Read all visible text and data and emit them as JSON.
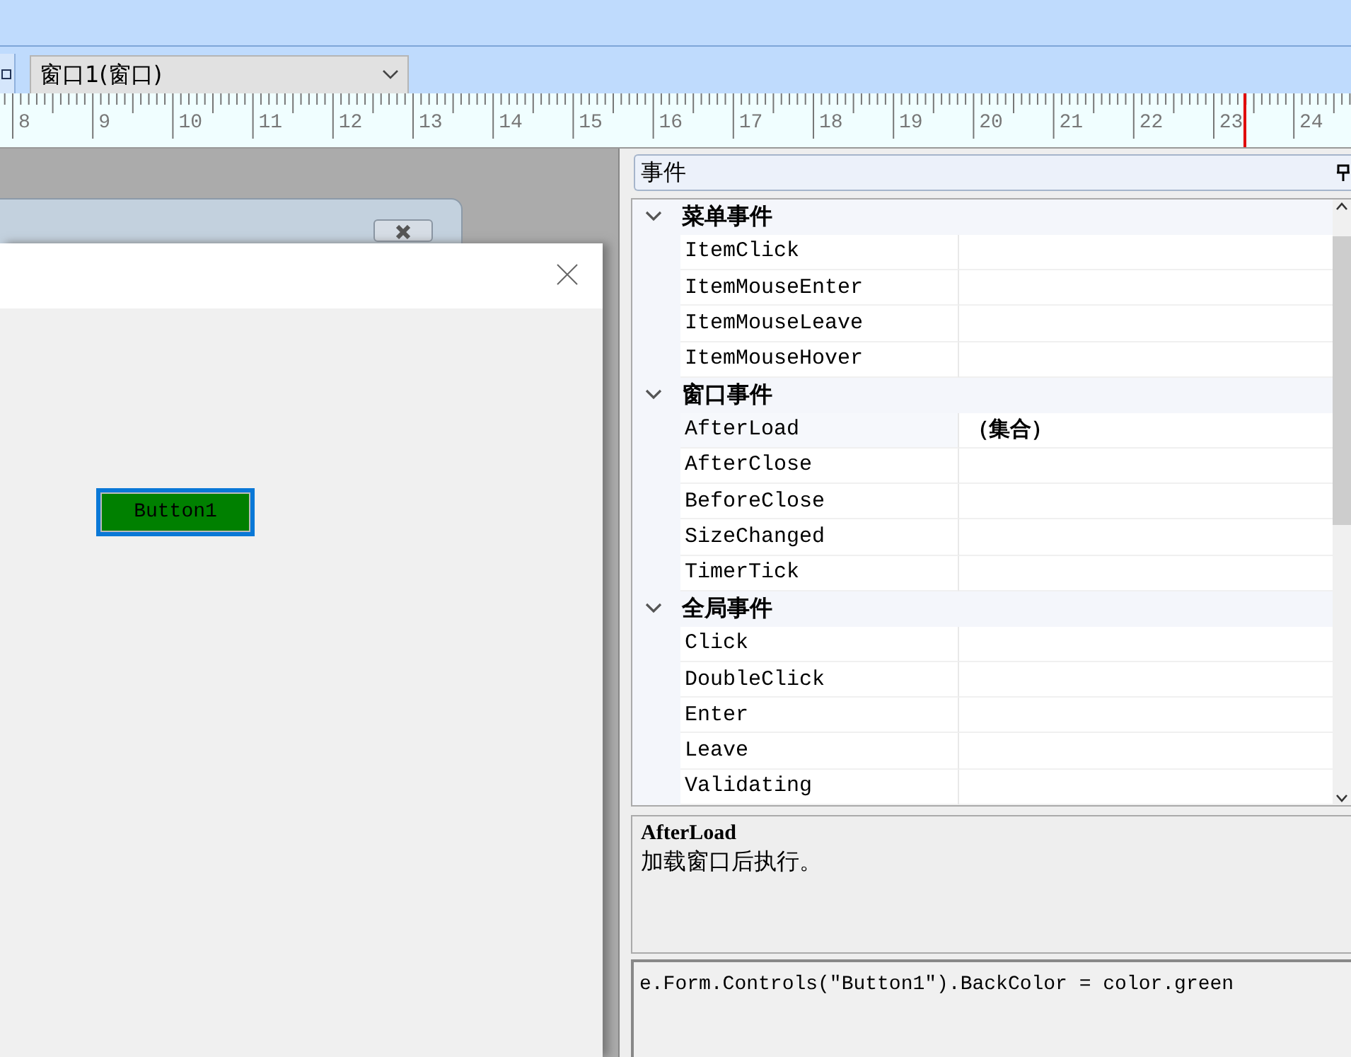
{
  "toolbar": {
    "object_combo": {
      "value": "窗口1(窗口)"
    }
  },
  "ruler": {
    "labels": [
      "8",
      "9",
      "10",
      "11",
      "12",
      "13",
      "14",
      "15",
      "16",
      "17",
      "18",
      "19",
      "20",
      "21",
      "22",
      "23",
      "24"
    ]
  },
  "designer": {
    "form_button": {
      "label": "Button1",
      "selected": true
    }
  },
  "events_panel": {
    "title": "事件",
    "categories": [
      {
        "name": "菜单事件",
        "expanded": true,
        "items": [
          {
            "name": "ItemClick",
            "selected": false
          },
          {
            "name": "ItemMouseEnter",
            "selected": false
          },
          {
            "name": "ItemMouseLeave",
            "selected": false
          },
          {
            "name": "ItemMouseHover",
            "selected": false
          }
        ]
      },
      {
        "name": "窗口事件",
        "expanded": true,
        "items": [
          {
            "name": "AfterLoad",
            "value": "（集合）",
            "selected": true
          },
          {
            "name": "AfterClose",
            "selected": false
          },
          {
            "name": "BeforeClose",
            "selected": false
          },
          {
            "name": "SizeChanged",
            "selected": false
          },
          {
            "name": "TimerTick",
            "selected": false
          }
        ]
      },
      {
        "name": "全局事件",
        "expanded": true,
        "items": [
          {
            "name": "Click",
            "selected": false
          },
          {
            "name": "DoubleClick",
            "selected": false
          },
          {
            "name": "Enter",
            "selected": false
          },
          {
            "name": "Leave",
            "selected": false
          },
          {
            "name": "Validating",
            "selected": false
          }
        ]
      }
    ],
    "description": {
      "title": "AfterLoad",
      "text": "加载窗口后执行。"
    },
    "code": "e.Form.Controls(\"Button1\").BackColor = color.green"
  }
}
